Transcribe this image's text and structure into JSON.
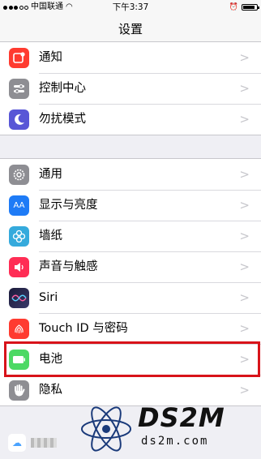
{
  "status_bar": {
    "carrier": "中国联通",
    "time": "下午3:37",
    "battery_level": 0.85
  },
  "nav": {
    "title": "设置"
  },
  "groups": [
    {
      "items": [
        {
          "label": "通知",
          "icon": "notifications-icon",
          "color": "#ff3b30"
        },
        {
          "label": "控制中心",
          "icon": "control-center-icon",
          "color": "#8e8e93"
        },
        {
          "label": "勿扰模式",
          "icon": "moon-icon",
          "color": "#5856d6"
        }
      ]
    },
    {
      "items": [
        {
          "label": "通用",
          "icon": "gear-icon",
          "color": "#8e8e93"
        },
        {
          "label": "显示与亮度",
          "icon": "display-icon",
          "color": "#1e7bf6",
          "glyph": "AA"
        },
        {
          "label": "墙纸",
          "icon": "wallpaper-icon",
          "color": "#35aadc"
        },
        {
          "label": "声音与触感",
          "icon": "sound-icon",
          "color": "#ff2d55"
        },
        {
          "label": "Siri",
          "icon": "siri-icon",
          "color": "#222244"
        },
        {
          "label": "Touch ID 与密码",
          "icon": "fingerprint-icon",
          "color": "#ff3b30"
        },
        {
          "label": "电池",
          "icon": "battery-icon",
          "color": "#4cd964"
        },
        {
          "label": "隐私",
          "icon": "privacy-hand-icon",
          "color": "#8e8e93"
        }
      ]
    }
  ],
  "watermark": {
    "title": "DS2M",
    "subtitle": "ds2m.com"
  }
}
